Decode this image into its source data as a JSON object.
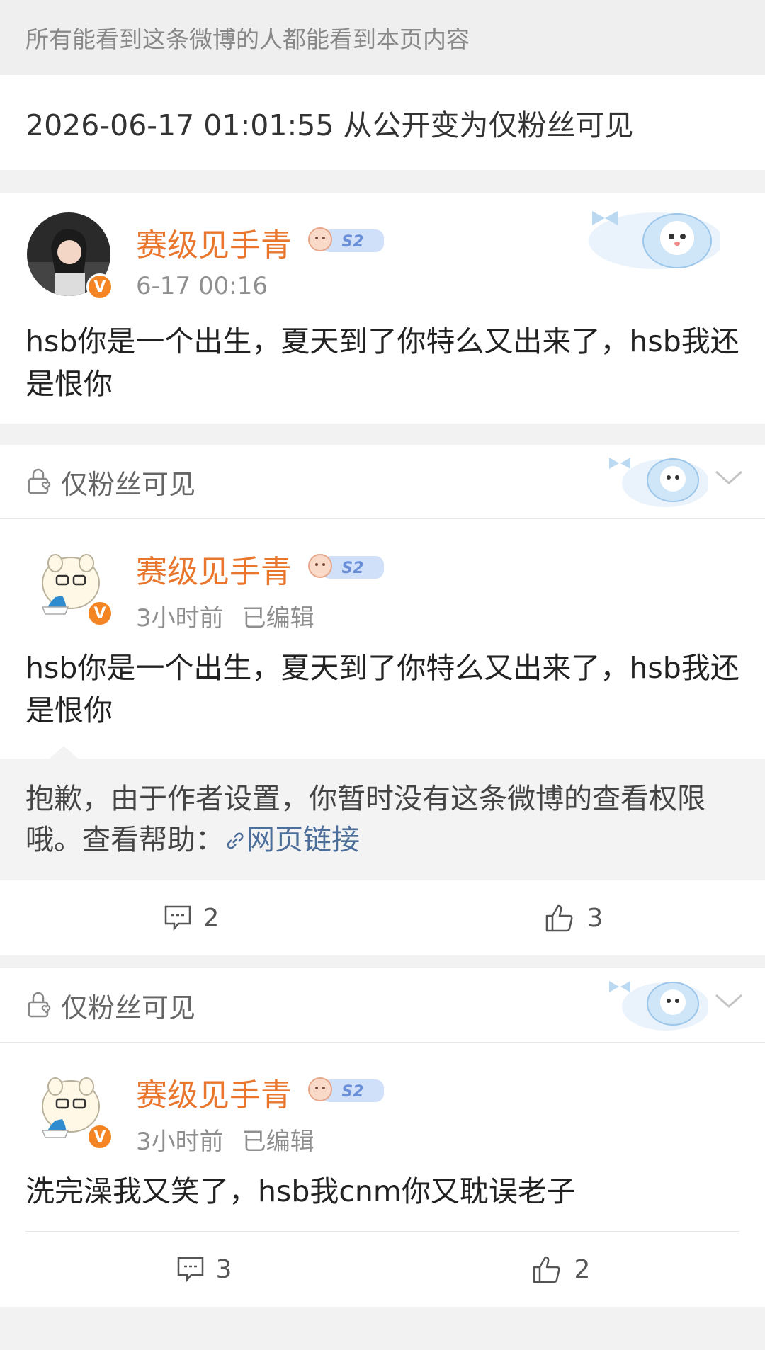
{
  "notice": "所有能看到这条微博的人都能看到本页内容",
  "change": "2026-06-17 01:01:55 从公开变为仅粉丝可见",
  "posts": [
    {
      "name": "赛级见手青",
      "level": "S2",
      "time": "6-17 00:16",
      "edited": "",
      "text": "hsb你是一个出生，夏天到了你特么又出来了，hsb我还是恨你"
    },
    {
      "visibility": "仅粉丝可见",
      "name": "赛级见手青",
      "level": "S2",
      "time": "3小时前",
      "edited": "已编辑",
      "text": "hsb你是一个出生，夏天到了你特么又出来了，hsb我还是恨你",
      "restricted_text": "抱歉，由于作者设置，你暂时没有这条微博的查看权限哦。查看帮助：",
      "link_text": "网页链接",
      "comments": "2",
      "likes": "3"
    },
    {
      "visibility": "仅粉丝可见",
      "name": "赛级见手青",
      "level": "S2",
      "time": "3小时前",
      "edited": "已编辑",
      "text": "洗完澡我又笑了，hsb我cnm你又耽误老子",
      "comments": "3",
      "likes": "2"
    }
  ],
  "colors": {
    "username": "#e8762d",
    "link": "#4d6e99",
    "verified_badge": "#f38525"
  },
  "icons": [
    "lock-heart-icon",
    "chevron-down-icon",
    "comment-icon",
    "thumbs-up-icon",
    "verified-badge-icon",
    "level-badge-icon"
  ]
}
